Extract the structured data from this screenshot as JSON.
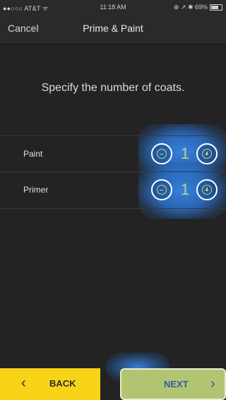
{
  "status_bar": {
    "carrier": "●●○○○ AT&T ᯤ",
    "time": "11:18 AM",
    "right_indicators": "⊕ ↗ ✱ 69%",
    "battery_level": 0.69
  },
  "nav": {
    "cancel_label": "Cancel",
    "title": "Prime & Paint"
  },
  "instruction": "Specify the number of coats.",
  "rows": [
    {
      "label": "Paint",
      "value": "1"
    },
    {
      "label": "Primer",
      "value": "1"
    }
  ],
  "footer": {
    "back_label": "BACK",
    "back_icon": "‹",
    "next_label": "NEXT",
    "next_icon": "›"
  },
  "colors": {
    "back_button": "#f7d417",
    "next_button": "#b2c472",
    "next_text": "#2e5fa6",
    "stepper_accent": "#b8d77a",
    "highlight_glow": "#3686e6"
  }
}
